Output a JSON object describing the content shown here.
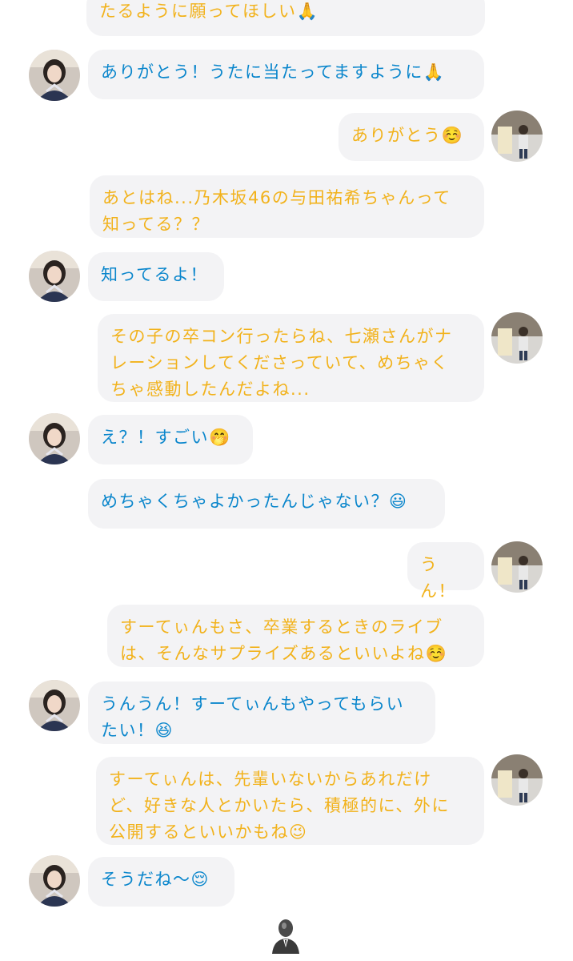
{
  "messages": [
    {
      "side": "right",
      "text": "たるように願ってほしい🙏"
    },
    {
      "side": "left",
      "text": "ありがとう！うたに当たってますように🙏"
    },
    {
      "side": "right",
      "text": "ありがとう☺️"
    },
    {
      "side": "right",
      "text": "あとはね...乃木坂46の与田祐希ちゃんって\n知ってる？？"
    },
    {
      "side": "left",
      "text": "知ってるよ！"
    },
    {
      "side": "right",
      "text": "その子の卒コン行ったらね、七瀬さんがナ\nレーションしてくださっていて、めちゃく\nちゃ感動したんだよね..."
    },
    {
      "side": "left",
      "text": "え？！すごい🤭"
    },
    {
      "side": "left",
      "text": "めちゃくちゃよかったんじゃない？😃"
    },
    {
      "side": "right",
      "text": "うん！"
    },
    {
      "side": "right",
      "text": "すーてぃんもさ、卒業するときのライブ\nは、そんなサプライズあるといいよね☺️"
    },
    {
      "side": "left",
      "text": "うんうん！すーてぃんもやってもらい\nたい！😆"
    },
    {
      "side": "right",
      "text": "すーてぃんは、先輩いないからあれだけ\nど、好きな人とかいたら、積極的に、外に\n公開するといいかもね😉"
    },
    {
      "side": "left",
      "text": "そうだね〜😌"
    }
  ],
  "colors": {
    "left_text": "#0a86cc",
    "right_text": "#f2b21b",
    "bubble_bg": "#f3f3f5"
  }
}
